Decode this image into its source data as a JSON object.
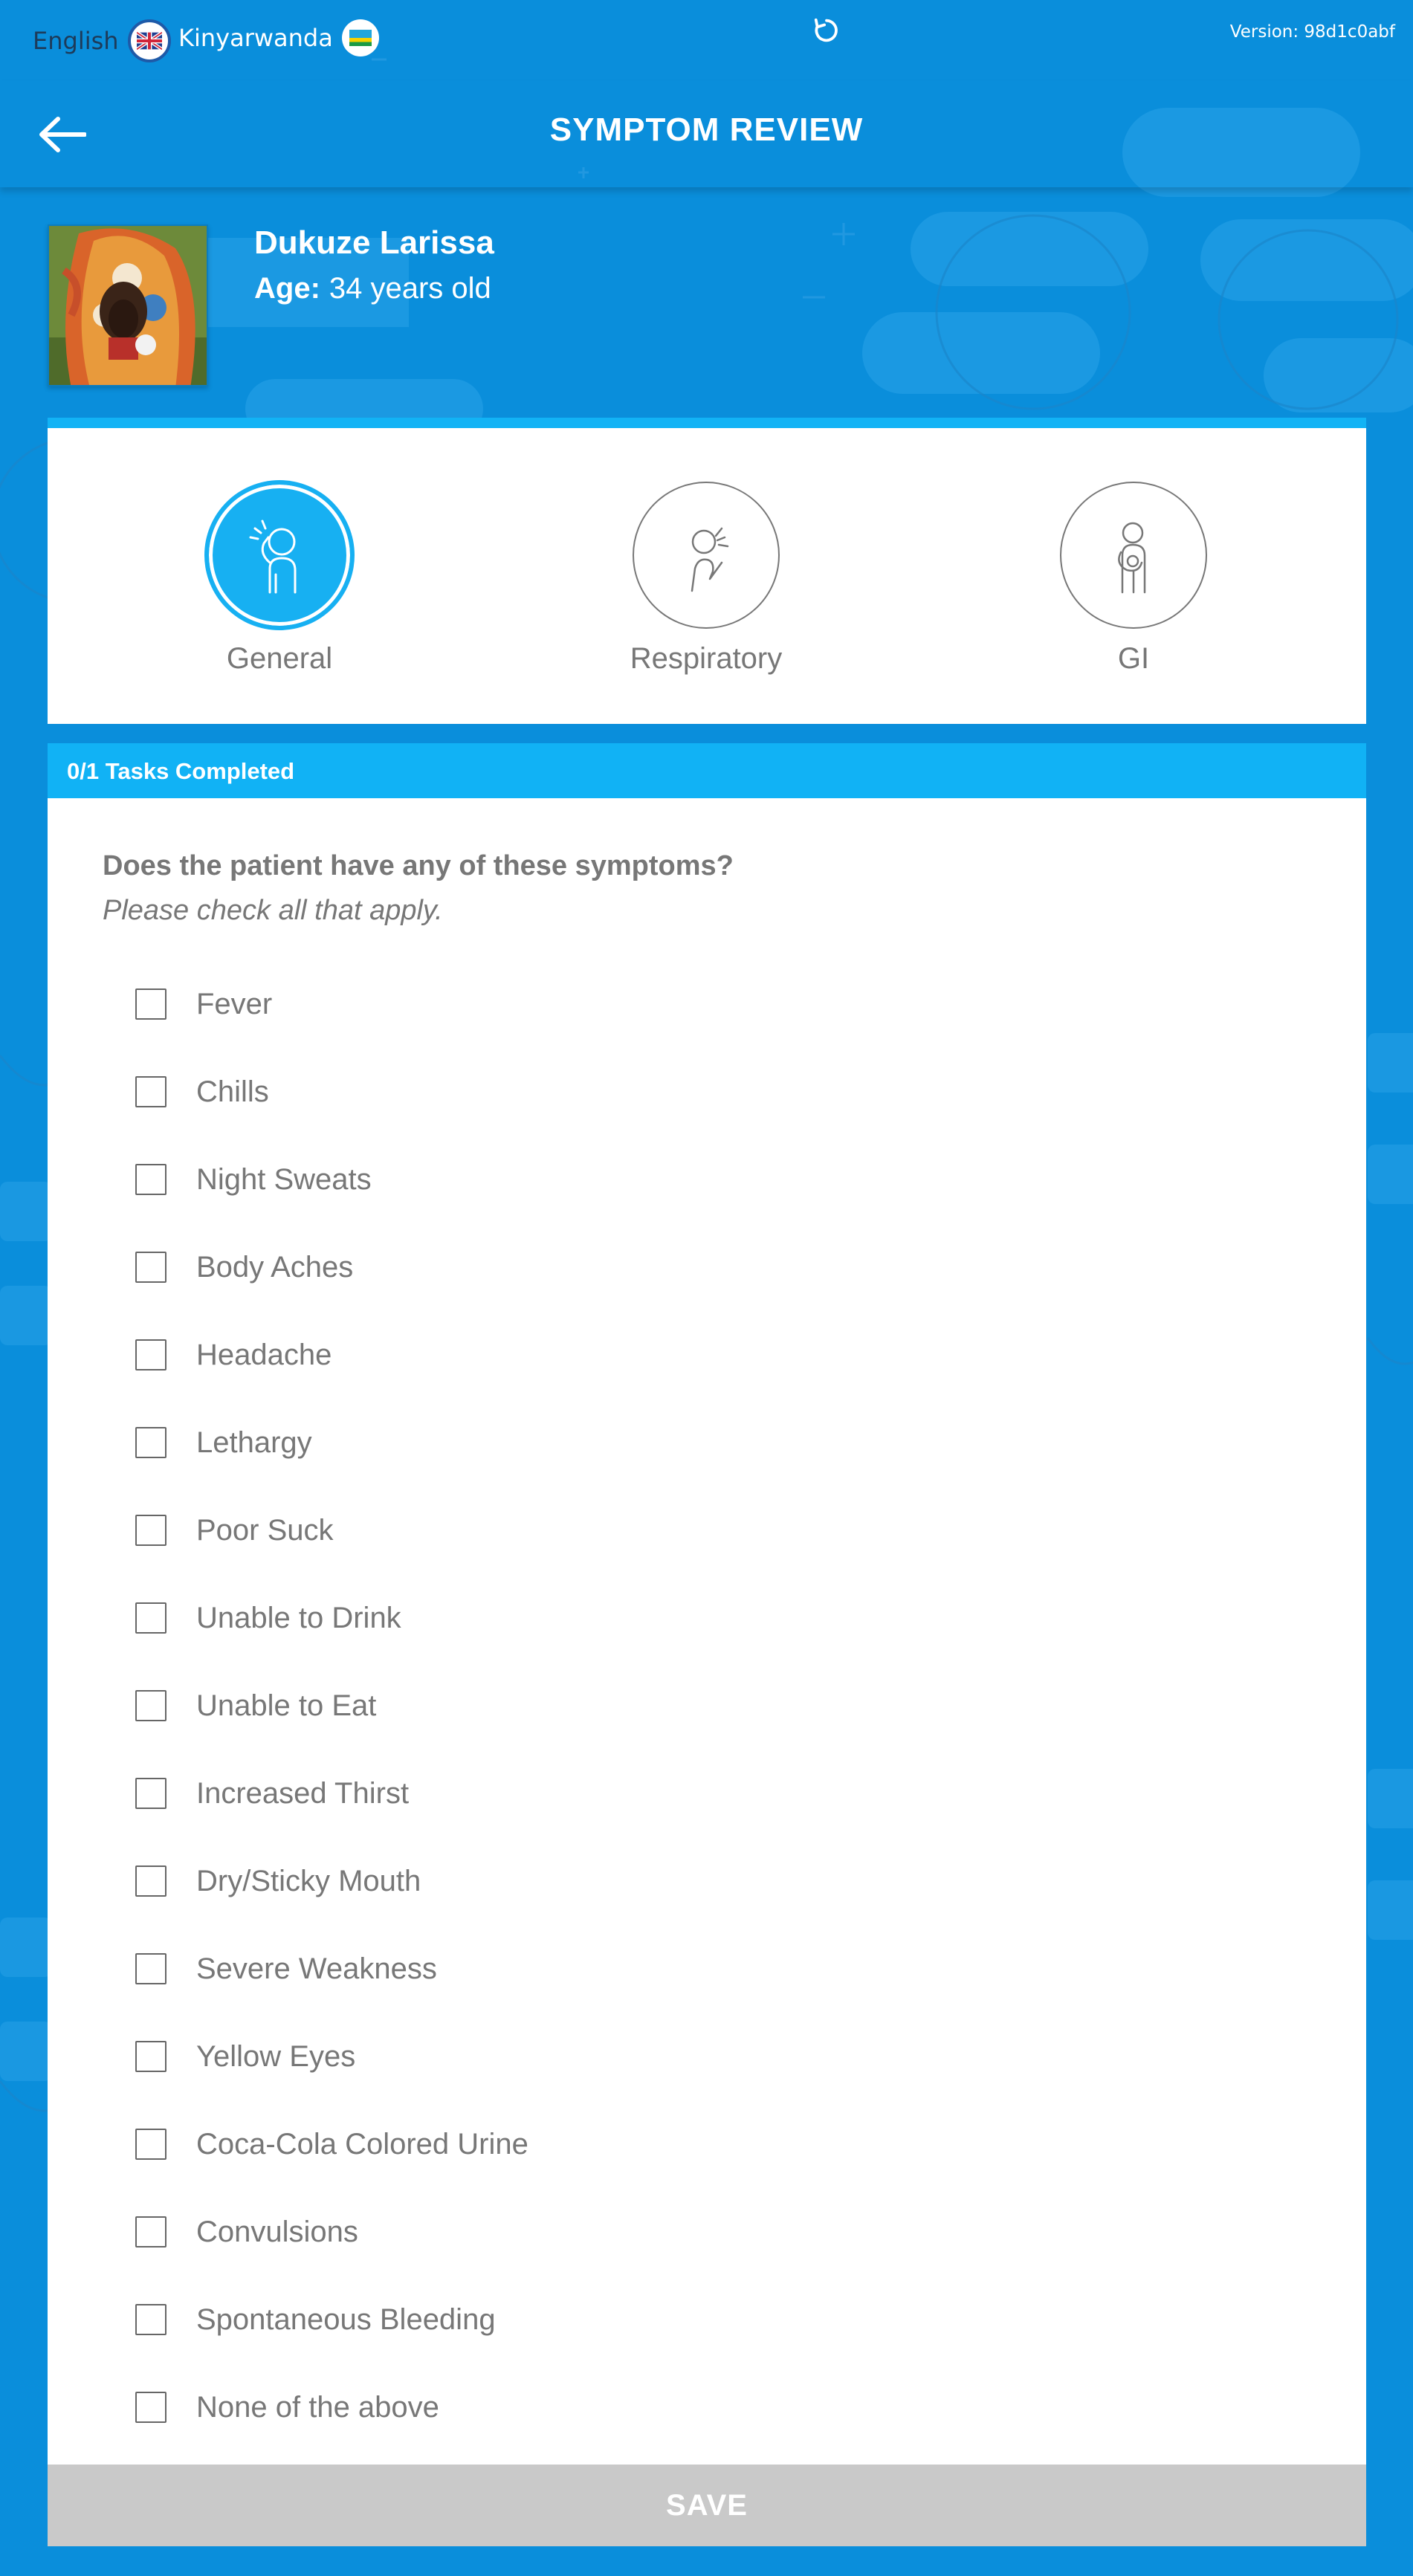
{
  "languages": [
    {
      "label": "English",
      "flag": "uk-flag-icon"
    },
    {
      "label": "Kinyarwanda",
      "flag": "rwanda-flag-icon"
    }
  ],
  "version": "Version: 98d1c0abf",
  "header": {
    "title": "SYMPTOM REVIEW"
  },
  "patient": {
    "name": "Dukuze Larissa",
    "age_label": "Age:",
    "age_value": "34 years old"
  },
  "tabs": [
    {
      "label": "General",
      "active": true,
      "icon": "general-symptom-icon"
    },
    {
      "label": "Respiratory",
      "active": false,
      "icon": "respiratory-symptom-icon"
    },
    {
      "label": "GI",
      "active": false,
      "icon": "gi-symptom-icon"
    }
  ],
  "progress": {
    "text": "0/1 Tasks Completed"
  },
  "form": {
    "question": "Does the patient have any of these symptoms?",
    "hint": "Please check all that apply.",
    "options": [
      "Fever",
      "Chills",
      "Night Sweats",
      "Body Aches",
      "Headache",
      "Lethargy",
      "Poor Suck",
      "Unable to Drink",
      "Unable to Eat",
      "Increased Thirst",
      "Dry/Sticky Mouth",
      "Severe Weakness",
      "Yellow Eyes",
      "Coca-Cola Colored Urine",
      "Convulsions",
      "Spontaneous Bleeding",
      "None of the above"
    ]
  },
  "save_label": "SAVE",
  "colors": {
    "background": "#0a8edb",
    "accent": "#12b3f5",
    "card": "#ffffff",
    "text": "#777777",
    "save_disabled": "#c9c9c9"
  }
}
